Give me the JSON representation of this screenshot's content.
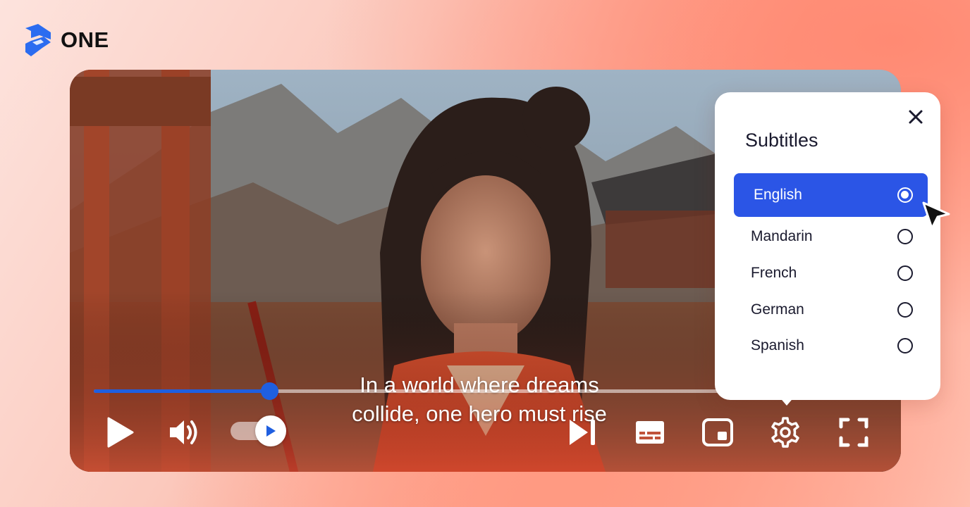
{
  "brand": {
    "name": "ONE",
    "icon": "one-logo-icon"
  },
  "player": {
    "caption_lines": [
      "In a world where dreams",
      "collide, one hero must rise"
    ],
    "progress": 0.28,
    "autoplay_on": true,
    "controls": {
      "play": "play-icon",
      "volume": "volume-icon",
      "next": "skip-next-icon",
      "subtitles": "subtitles-icon",
      "pip": "picture-in-picture-icon",
      "settings": "gear-icon",
      "fullscreen": "fullscreen-icon"
    }
  },
  "subtitles_panel": {
    "title": "Subtitles",
    "close_icon": "close-icon",
    "options": [
      {
        "label": "English",
        "selected": true
      },
      {
        "label": "Mandarin",
        "selected": false
      },
      {
        "label": "French",
        "selected": false
      },
      {
        "label": "German",
        "selected": false
      },
      {
        "label": "Spanish",
        "selected": false
      }
    ]
  },
  "colors": {
    "accent": "#2b55e6",
    "progress": "#1f5fe0",
    "text_dark": "#1a1a2e"
  }
}
